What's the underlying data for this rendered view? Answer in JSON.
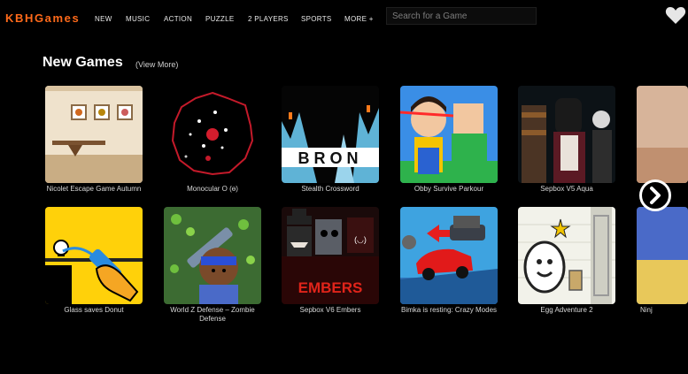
{
  "header": {
    "logo": "KBHGames",
    "nav": [
      "NEW",
      "MUSIC",
      "ACTION",
      "PUZZLE",
      "2 PLAYERS",
      "SPORTS",
      "MORE +"
    ],
    "search_placeholder": "Search for a Game"
  },
  "section": {
    "title": "New Games",
    "view_more": "(View More)"
  },
  "games": [
    {
      "label": "Nicolet Escape Game Autumn"
    },
    {
      "label": "Monocular O (ɵ)"
    },
    {
      "label": "Stealth Crossword",
      "thumb_text": "BRON"
    },
    {
      "label": "Obby Survive Parkour"
    },
    {
      "label": "Sepbox V5 Aqua"
    },
    {
      "label": "Glass saves Donut"
    },
    {
      "label": "World Z Defense – Zombie Defense"
    },
    {
      "label": "Sepbox V6 Embers",
      "thumb_text": "EMBERS"
    },
    {
      "label": "Bimka is resting: Crazy Modes"
    },
    {
      "label": "Egg Adventure 2"
    },
    {
      "label": "Ninj"
    }
  ],
  "colors": {
    "logo": "#ff6a1a",
    "background": "#000000"
  }
}
